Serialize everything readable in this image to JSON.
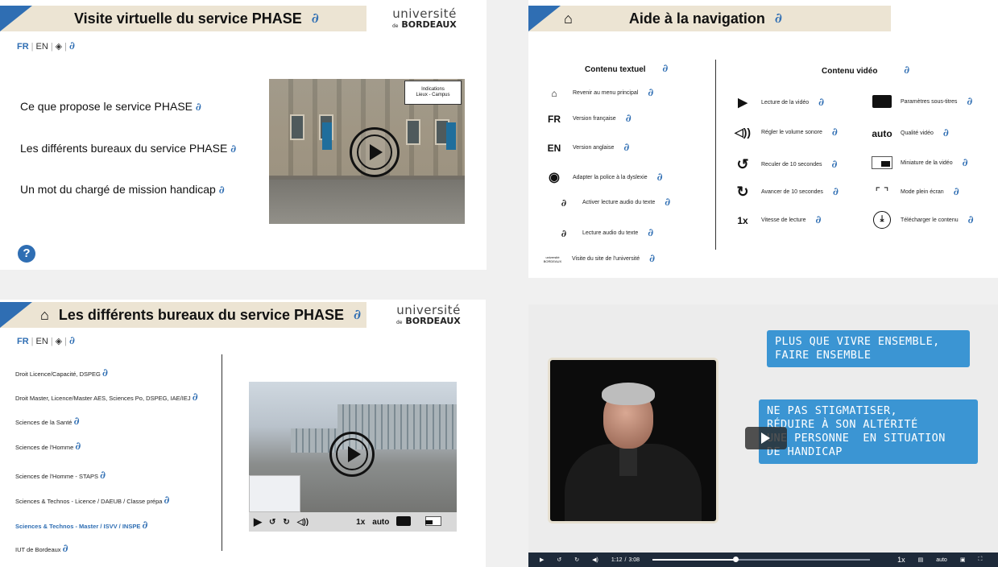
{
  "panel1": {
    "title": "Visite virtuelle du service PHASE",
    "logo_top": "université",
    "logo_de": "de",
    "logo_bottom": "BORDEAUX",
    "lang": [
      "FR",
      "EN"
    ],
    "items": [
      "Ce que propose le service PHASE",
      "Les différents bureaux du service PHASE",
      "Un mot du chargé de mission handicap"
    ],
    "video_overlay_line1": "Indications",
    "video_overlay_line2": "Lieux - Campus",
    "help_glyph": "?"
  },
  "panel2": {
    "title": "Aide à la navigation",
    "text_col_title": "Contenu textuel",
    "video_col_title": "Contenu vidéo",
    "text_items": [
      {
        "icon": "home-icon",
        "glyph": "🏠",
        "label": "Revenir au menu principal"
      },
      {
        "icon": "fr-icon",
        "glyph": "FR",
        "label": "Version française"
      },
      {
        "icon": "en-icon",
        "glyph": "EN",
        "label": "Version anglaise"
      },
      {
        "icon": "dyslexia-eye-icon",
        "glyph": "◉",
        "label": "Adapter la police à la dyslexie"
      },
      {
        "icon": "ear-slash-icon",
        "glyph": "∂",
        "label": "Activer lecture audio du texte"
      },
      {
        "icon": "ear-icon",
        "glyph": "∂",
        "label": "Lecture audio du texte"
      },
      {
        "icon": "university-logo-icon",
        "glyph": "université BORDEAUX",
        "label": "Visite du site de l'université"
      }
    ],
    "video_items_left": [
      {
        "icon": "play-icon",
        "glyph": "▶",
        "label": "Lecture de la vidéo"
      },
      {
        "icon": "volume-icon",
        "glyph": "🔊",
        "label": "Régler le volume sonore"
      },
      {
        "icon": "rewind-icon",
        "glyph": "↺",
        "label": "Reculer de 10 secondes"
      },
      {
        "icon": "forward-icon",
        "glyph": "↻",
        "label": "Avancer de 10 secondes"
      },
      {
        "icon": "speed-icon",
        "glyph": "1x",
        "label": "Vitesse de lecture"
      }
    ],
    "video_items_right": [
      {
        "icon": "subtitles-icon",
        "glyph": "▬",
        "label": "Paramètres sous-titres"
      },
      {
        "icon": "quality-icon",
        "glyph": "auto",
        "label": "Qualité vidéo"
      },
      {
        "icon": "miniplayer-icon",
        "glyph": "▭",
        "label": "Miniature de la vidéo"
      },
      {
        "icon": "fullscreen-icon",
        "glyph": "⛶",
        "label": "Mode plein écran"
      },
      {
        "icon": "download-icon",
        "glyph": "⤓",
        "label": "Télécharger le contenu"
      }
    ]
  },
  "panel3": {
    "title": "Les différents bureaux du service PHASE",
    "logo_top": "université",
    "logo_de": "de",
    "logo_bottom": "BORDEAUX",
    "lang": [
      "FR",
      "EN"
    ],
    "items": [
      "Droit Licence/Capacité, DSPEG",
      "Droit Master, Licence/Master AES, Sciences Po, DSPEG, IAE/IEJ",
      "Sciences de la Santé",
      "Sciences de l'Homme",
      "Sciences de l'Homme -  STAPS",
      "Sciences & Technos -  Licence / DAEUB / Classe prépa",
      "Sciences & Technos - Master / ISVV / INSPE",
      "IUT de Bordeaux"
    ],
    "active_index": 6,
    "controls": {
      "speed": "1x",
      "quality": "auto"
    }
  },
  "panel4": {
    "bubble1": "PLUS QUE VIVRE ENSEMBLE,\nFAIRE ENSEMBLE",
    "bubble2": "NE PAS STIGMATISER,\nRÉDUIRE À SON ALTÉRITÉ\nUNE PERSONNE  EN SITUATION\nDE HANDICAP",
    "player": {
      "current_time": "1:12",
      "separator": "/",
      "duration": "3:08",
      "progress_fraction": 0.38,
      "speed": "1x",
      "quality": "auto"
    }
  },
  "colors": {
    "accent_blue": "#2f6eb3",
    "title_band": "#ece4d3",
    "bubble_blue": "#3b95d3",
    "player_bar": "#1e2a3a"
  }
}
